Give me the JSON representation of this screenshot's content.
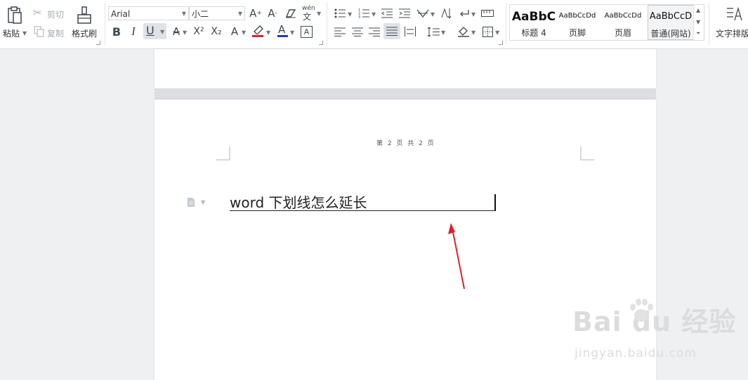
{
  "clipboard": {
    "paste_label": "粘贴",
    "cut_label": "剪切",
    "copy_label": "复制",
    "format_painter_label": "格式刷"
  },
  "font": {
    "family_value": "Arial",
    "size_value": "小二",
    "pinyin_glyph": "wén"
  },
  "format_buttons": {
    "bold": "B",
    "italic": "I",
    "underline": "U",
    "superscript": "X²",
    "subscript": "X₂",
    "text_effect": "A",
    "font_color": "A",
    "char_border": "A"
  },
  "styles": {
    "items": [
      {
        "preview": "AaBbC",
        "name": "标题 4"
      },
      {
        "preview": "AaBbCcDd",
        "name": "页脚"
      },
      {
        "preview": "AaBbCcDd",
        "name": "页眉"
      },
      {
        "preview": "AaBbCcD",
        "name": "普通(网站)"
      }
    ]
  },
  "layout_tab": {
    "label": "文字排版"
  },
  "document": {
    "header_text": "第 2 页 共 2 页",
    "body_text": "word 下划线怎么延长"
  },
  "watermark": {
    "main": "Bai du 经验",
    "sub": "jingyan.baidu.com"
  },
  "colors": {
    "font_color_bar": "#1a3ad6",
    "highlight_bar": "#e0202a",
    "arrow": "#e0202a",
    "ribbon_bg": "#ffffff",
    "workspace_bg": "#eef0f2"
  }
}
